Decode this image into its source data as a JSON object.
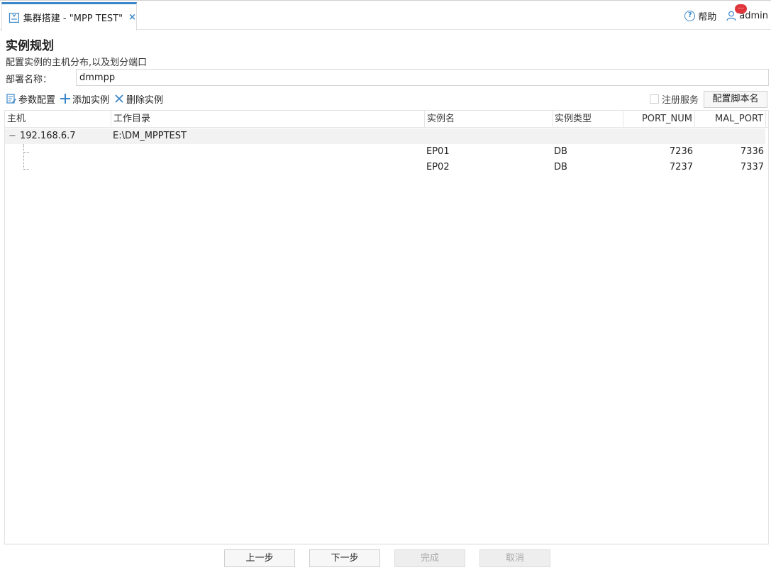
{
  "tab": {
    "title": "集群搭建 - \"MPP TEST\"",
    "close": "×"
  },
  "topbar": {
    "help_label": "帮助",
    "user_name": "admin",
    "badge": "..."
  },
  "page": {
    "heading": "实例规划",
    "subheading": "配置实例的主机分布,以及划分端口",
    "deploy_name_label": "部署名称：",
    "deploy_name_value": "dmmpp"
  },
  "toolbar": {
    "param_config": "参数配置",
    "add_instance": "添加实例",
    "delete_instance": "删除实例",
    "register_service": "注册服务",
    "config_script_name": "配置脚本名"
  },
  "table": {
    "columns": [
      "主机",
      "工作目录",
      "实例名",
      "实例类型",
      "PORT_NUM",
      "MAL_PORT"
    ],
    "host_group": {
      "expander": "−",
      "host": "192.168.6.7",
      "work_dir": "E:\\DM_MPPTEST"
    },
    "rows": [
      {
        "instance": "EP01",
        "type": "DB",
        "port_num": "7236",
        "mal_port": "7336"
      },
      {
        "instance": "EP02",
        "type": "DB",
        "port_num": "7237",
        "mal_port": "7337"
      }
    ]
  },
  "footer": {
    "prev": "上一步",
    "next": "下一步",
    "finish": "完成",
    "cancel": "取消"
  }
}
